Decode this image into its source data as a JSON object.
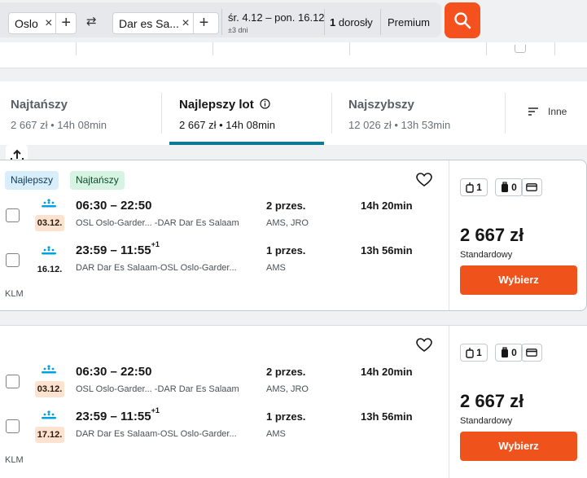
{
  "search": {
    "origin": "Oslo",
    "destination": "Dar es Sa...",
    "dates": "śr. 4.12 – pon. 16.12",
    "flex": "±3 dni",
    "passengers_count": "1",
    "passengers_label": "dorosły",
    "cabin": "Premium"
  },
  "sort_tabs": [
    {
      "label": "Najtańszy",
      "summary": "2 667 zł • 14h 08min"
    },
    {
      "label": "Najlepszy lot",
      "summary": "2 667 zł • 14h 08min"
    },
    {
      "label": "Najszybszy",
      "summary": "12 026 zł • 13h 53min"
    }
  ],
  "more_label": "Inne",
  "results": [
    {
      "badges": [
        "Najlepszy",
        "Najtańszy"
      ],
      "legs": [
        {
          "date": "03.12.",
          "times": "06:30 – 22:50",
          "next_day": "",
          "route": "OSL Oslo-Garder... -DAR Dar Es Salaam",
          "stops": "2 przes.",
          "via": "AMS, JRO",
          "duration": "14h 20min"
        },
        {
          "date": "16.12.",
          "times": "23:59 – 11:55",
          "next_day": "+1",
          "route": "DAR Dar Es Salaam-OSL Oslo-Garder...",
          "stops": "1 przes.",
          "via": "AMS",
          "duration": "13h 56min"
        }
      ],
      "airline": "KLM",
      "bags": {
        "cabin": "1",
        "checked": "0"
      },
      "price": "2 667 zł",
      "fare": "Standardowy",
      "select_label": "Wybierz"
    },
    {
      "badges": [],
      "legs": [
        {
          "date": "03.12.",
          "times": "06:30 – 22:50",
          "next_day": "",
          "route": "OSL Oslo-Garder... -DAR Dar Es Salaam",
          "stops": "2 przes.",
          "via": "AMS, JRO",
          "duration": "14h 20min"
        },
        {
          "date": "17.12.",
          "times": "23:59 – 11:55",
          "next_day": "+1",
          "route": "DAR Dar Es Salaam-OSL Oslo-Garder...",
          "stops": "1 przes.",
          "via": "AMS",
          "duration": "13h 56min"
        }
      ],
      "airline": "KLM",
      "bags": {
        "cabin": "1",
        "checked": "0"
      },
      "price": "2 667 zł",
      "fare": "Standardowy",
      "select_label": "Wybierz"
    }
  ],
  "colors": {
    "accent": "#f4511e",
    "tab_underline": "#0b7b93",
    "date_highlight": "#fde3cf",
    "badge_best": "#d8eefb",
    "badge_cheapest": "#d7f3e2"
  }
}
